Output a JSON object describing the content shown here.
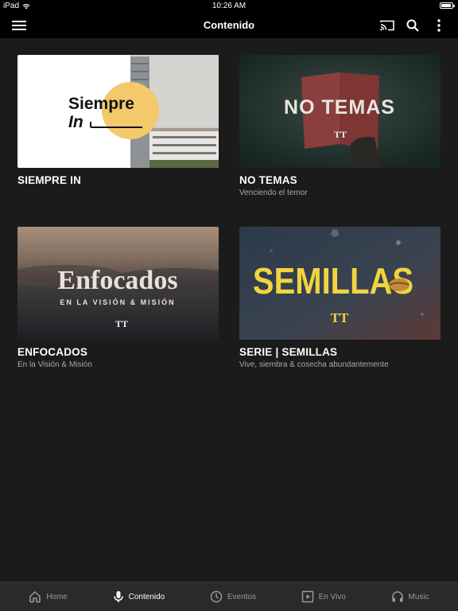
{
  "status_bar": {
    "device": "iPad",
    "time": "10:26 AM",
    "battery_level": 0.9
  },
  "header": {
    "title": "Contenido"
  },
  "icons": {
    "menu": "hamburger-icon",
    "cast": "cast-icon",
    "search": "search-icon",
    "more": "more-vertical-icon"
  },
  "cards": [
    {
      "title": "SIEMPRE IN",
      "subtitle": "",
      "art_text_line1": "Siempre",
      "art_text_line2": "In",
      "colors": {
        "circle": "#f3c96b"
      }
    },
    {
      "title": "NO TEMAS",
      "subtitle": "Venciendo el temor",
      "art_text": "NO TEMAS",
      "logo": "TT"
    },
    {
      "title": "ENFOCADOS",
      "subtitle": "En la Visión & Misión",
      "art_text": "Enfocados",
      "art_subtext": "EN LA VISIÓN & MISIÓN",
      "logo": "TT"
    },
    {
      "title": "SERIE | SEMILLAS",
      "subtitle": "Vive, siembra & cosecha abundantemente",
      "art_text": "SEMILLAS",
      "logo": "TT",
      "colors": {
        "text": "#f0d440"
      }
    }
  ],
  "nav": [
    {
      "label": "Home",
      "icon": "home-icon",
      "active": false
    },
    {
      "label": "Contenido",
      "icon": "microphone-icon",
      "active": true
    },
    {
      "label": "Eventos",
      "icon": "clock-icon",
      "active": false
    },
    {
      "label": "En Vivo",
      "icon": "play-icon",
      "active": false
    },
    {
      "label": "Music",
      "icon": "headphones-icon",
      "active": false
    }
  ]
}
